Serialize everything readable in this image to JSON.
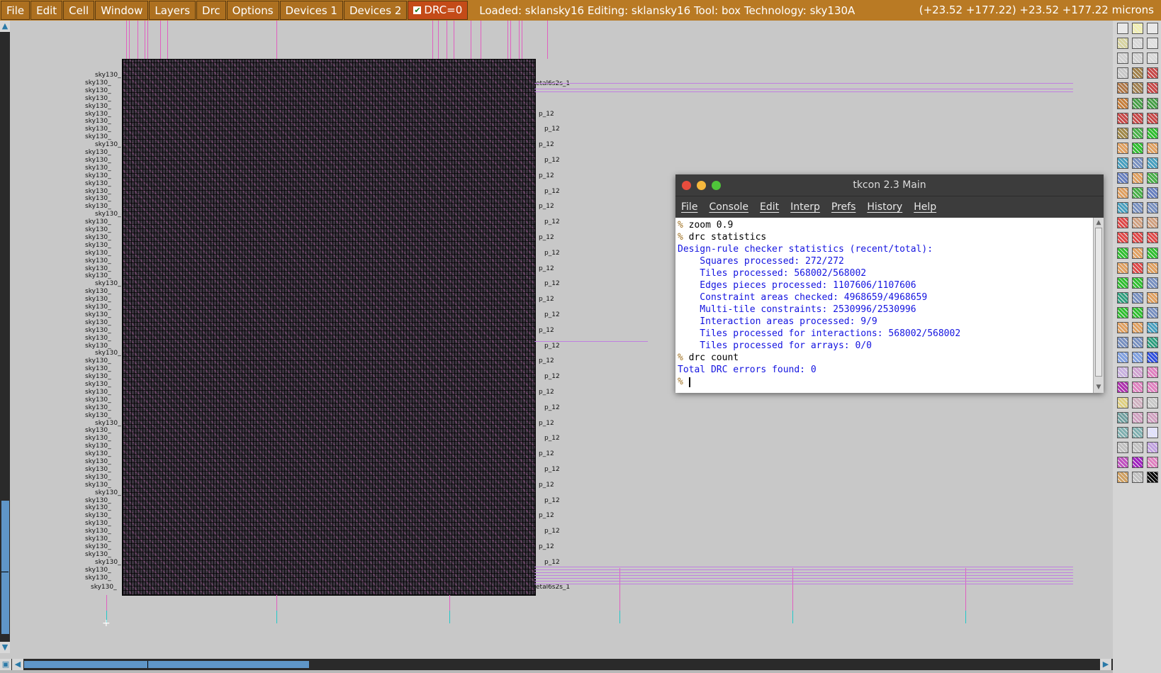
{
  "menubar": {
    "items": [
      "File",
      "Edit",
      "Cell",
      "Window",
      "Layers",
      "Drc",
      "Options",
      "Devices 1",
      "Devices 2"
    ],
    "drc_toggle": "DRC=0",
    "status": "Loaded: sklansky16 Editing: sklansky16 Tool: box  Technology: sky130A",
    "coords": "(+23.52 +177.22) +23.52 +177.22 microns"
  },
  "canvas": {
    "top_label_right": "etal6s2s_1",
    "bottom_label_left": "sky130_",
    "bottom_label_right": "etal6s2s_1",
    "row_prefix": "sky130_",
    "row_suffix": "p_12"
  },
  "tkcon": {
    "title": "tkcon 2.3 Main",
    "menu": [
      "File",
      "Console",
      "Edit",
      "Interp",
      "Prefs",
      "History",
      "Help"
    ],
    "lines": [
      {
        "prompt": "% ",
        "text": "zoom 0.9",
        "kind": "cmd"
      },
      {
        "prompt": "% ",
        "text": "drc statistics",
        "kind": "cmd"
      },
      {
        "prompt": "",
        "text": "Design-rule checker statistics (recent/total):",
        "kind": "out"
      },
      {
        "prompt": "",
        "text": "    Squares processed: 272/272",
        "kind": "out"
      },
      {
        "prompt": "",
        "text": "    Tiles processed: 568002/568002",
        "kind": "out"
      },
      {
        "prompt": "",
        "text": "    Edges pieces processed: 1107606/1107606",
        "kind": "out"
      },
      {
        "prompt": "",
        "text": "    Constraint areas checked: 4968659/4968659",
        "kind": "out"
      },
      {
        "prompt": "",
        "text": "    Multi-tile constraints: 2530996/2530996",
        "kind": "out"
      },
      {
        "prompt": "",
        "text": "    Interaction areas processed: 9/9",
        "kind": "out"
      },
      {
        "prompt": "",
        "text": "    Tiles processed for interactions: 568002/568002",
        "kind": "out"
      },
      {
        "prompt": "",
        "text": "    Tiles processed for arrays: 0/0",
        "kind": "out"
      },
      {
        "prompt": "% ",
        "text": "drc count",
        "kind": "cmd"
      },
      {
        "prompt": "",
        "text": "Total DRC errors found: 0",
        "kind": "out"
      },
      {
        "prompt": "% ",
        "text": "",
        "kind": "input"
      }
    ]
  },
  "colors": {
    "menubar_bg": "#b97a24",
    "drc_bg": "#c44b18",
    "console_output": "#1414e0",
    "scroll_thumb": "#5f96c8"
  }
}
